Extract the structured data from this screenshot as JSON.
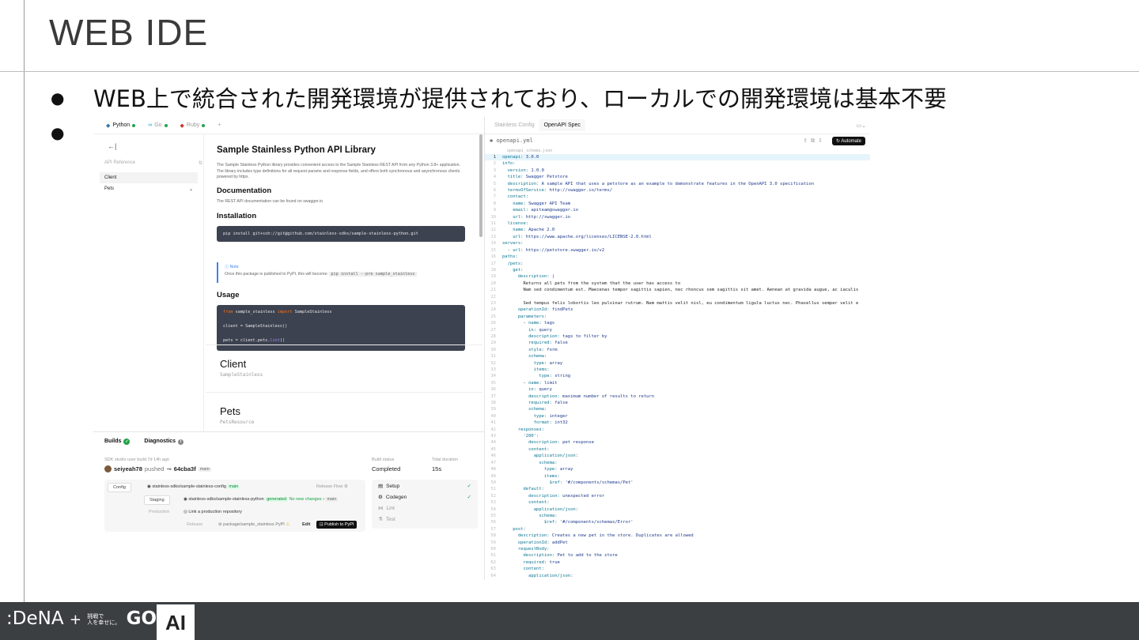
{
  "slide": {
    "title": "WEB IDE",
    "bullet1": "WEB上で統合された開発環境が提供されており、ローカルでの開発環境は基本不要",
    "bullet_marker": "●"
  },
  "left_tabs": [
    {
      "label": "Python",
      "active": true
    },
    {
      "label": "Go",
      "active": false
    },
    {
      "label": "Ruby",
      "active": false
    },
    {
      "label": "+"
    }
  ],
  "sidebar": {
    "back": "←|",
    "section": "API Reference",
    "section_icon": "⇅",
    "items": [
      "Client",
      "Pets"
    ],
    "pets_icon": "⌄"
  },
  "docs": {
    "title": "Sample Stainless Python API Library",
    "intro": "The Sample Stainless Python library provides convenient access to the Sample Stainless REST API from any Python 3.8+ application. The library includes type definitions for all request params and response fields, and offers both synchronous and asynchronous clients powered by httpx.",
    "doc_heading": "Documentation",
    "doc_text": "The REST API documentation can be found on swagger.io",
    "install_heading": "Installation",
    "install_cmd": "pip install git+ssh://git@github.com/stainless-sdks/sample-stainless-python.git",
    "note_label": "Note",
    "note_text": "Once this package is published to PyPI, this will become:",
    "note_code": "pip install --pre sample_stainless",
    "usage_heading": "Usage",
    "usage_code": [
      {
        "kw": "from",
        "rest": " sample_stainless ",
        "kw2": "import",
        "rest2": " SampleStainless"
      },
      {
        "kw": "",
        "rest": "client = SampleStainless()",
        "kw2": "",
        "rest2": ""
      },
      {
        "kw": "",
        "rest": "pets = client.pets.",
        "kw2": "list",
        "rest2": "()"
      }
    ],
    "client_title": "Client",
    "client_sub": "SampleStainless",
    "pets_title": "Pets",
    "pets_sub": "PetsResource"
  },
  "bottom": {
    "tab_builds": "Builds",
    "tab_diag": "Diagnostics",
    "build_label": "SDK studio user build",
    "build_time": "7d 14h ago",
    "user": "seiyeah78",
    "action": "pushed",
    "commit": "64cba3f",
    "branch": "main",
    "status_label": "Build status",
    "status_value": "Completed",
    "duration_label": "Total duration",
    "duration_value": "15s",
    "flow": {
      "config": "Config",
      "config_repo": "stainless-sdks/sample-stainless-config",
      "config_branch": "main",
      "release_flow": "Release Flow",
      "staging": "Staging",
      "staging_repo": "stainless-sdks/sample-stainless-python",
      "generated": "generated",
      "no_changes": "No new changes",
      "staging_branch": "main",
      "production": "Production",
      "prod_link": "Link a production repository",
      "release": "Release",
      "package": "package/sample_stainless",
      "pypi": "PyPI",
      "edit": "Edit",
      "publish": "Publish to PyPI"
    },
    "steps": [
      {
        "label": "Setup",
        "icon": "▤",
        "done": true
      },
      {
        "label": "Codegen",
        "icon": "⚙",
        "done": true
      },
      {
        "label": "Lint",
        "icon": "⋈",
        "done": false
      },
      {
        "label": "Test",
        "icon": "⚗",
        "done": false
      }
    ]
  },
  "right_tabs": [
    {
      "label": "Stainless Config",
      "active": false
    },
    {
      "label": "OpenAPI Spec",
      "active": true
    }
  ],
  "editor": {
    "filename": "openapi.yml",
    "crumb": "openapi_schema.json",
    "automate": "Automate",
    "lines": [
      "openapi: 3.0.0",
      "info:",
      "  version: 1.0.0",
      "  title: Swagger Petstore",
      "  description: A sample API that uses a petstore as an example to demonstrate features in the OpenAPI 3.0 specification",
      "  termsOfService: http://swagger.io/terms/",
      "  contact:",
      "    name: Swagger API Team",
      "    email: apiteam@swagger.io",
      "    url: http://swagger.io",
      "  license:",
      "    name: Apache 2.0",
      "    url: https://www.apache.org/licenses/LICENSE-2.0.html",
      "servers:",
      "  - url: https://petstore.swagger.io/v2",
      "paths:",
      "  /pets:",
      "    get:",
      "      description: |",
      "        Returns all pets from the system that the user has access to",
      "        Nam sed condimentum est. Maecenas tempor sagittis sapien, nec rhoncus sem sagittis sit amet. Aenean at gravida augue, ac iaculis",
      "",
      "        Sed tempus felis lobortis leo pulvinar rutrum. Nam mattis velit nisl, eu condimentum ligula luctus nec. Phasellus semper velit e",
      "      operationId: findPets",
      "      parameters:",
      "        - name: tags",
      "          in: query",
      "          description: tags to filter by",
      "          required: false",
      "          style: form",
      "          schema:",
      "            type: array",
      "            items:",
      "              type: string",
      "        - name: limit",
      "          in: query",
      "          description: maximum number of results to return",
      "          required: false",
      "          schema:",
      "            type: integer",
      "            format: int32",
      "      responses:",
      "        '200':",
      "          description: pet response",
      "          content:",
      "            application/json:",
      "              schema:",
      "                type: array",
      "                items:",
      "                  $ref: '#/components/schemas/Pet'",
      "        default:",
      "          description: unexpected error",
      "          content:",
      "            application/json:",
      "              schema:",
      "                $ref: '#/components/schemas/Error'",
      "    post:",
      "      description: Creates a new pet in the store. Duplicates are allowed",
      "      operationId: addPet",
      "      requestBody:",
      "        description: Pet to add to the store",
      "        required: true",
      "        content:",
      "          application/json:"
    ]
  },
  "footer": {
    "brand": ":DeNA",
    "plus": "+",
    "tag1": "挑戦で",
    "tag2": "人を幸せに。",
    "go": "GO",
    "ai": "AI"
  }
}
